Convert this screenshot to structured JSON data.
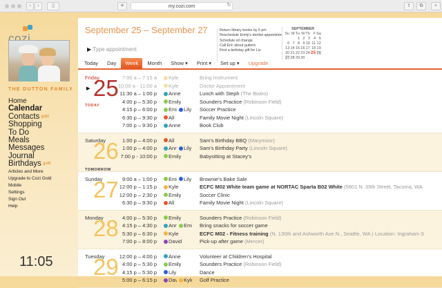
{
  "browser": {
    "url": "my.cozi.com"
  },
  "sidebar": {
    "logo": "cozi",
    "family": "THE DUTTON FAMILY",
    "nav": [
      {
        "label": "Home",
        "size": "md"
      },
      {
        "label": "Calendar",
        "size": "big",
        "selected": true
      },
      {
        "label": "Contacts",
        "size": "big",
        "badge": "gold"
      },
      {
        "label": "Shopping",
        "size": "big"
      },
      {
        "label": "To Do",
        "size": "big"
      },
      {
        "label": "Meals",
        "size": "big"
      },
      {
        "label": "Messages",
        "size": "big"
      },
      {
        "label": "Journal",
        "size": "big"
      },
      {
        "label": "Birthdays",
        "size": "big",
        "badge": "gold"
      },
      {
        "label": "Articles and More",
        "size": "sm"
      },
      {
        "label": "Upgrade to Cozi Gold",
        "size": "sm"
      },
      {
        "label": "Mobile",
        "size": "sm"
      },
      {
        "label": "Settings",
        "size": "sm"
      },
      {
        "label": "Sign Out",
        "size": "sm"
      },
      {
        "label": "Help",
        "size": "sm"
      }
    ],
    "clock": "11:05"
  },
  "header": {
    "range": "September 25 – September 27",
    "type_placeholder": "Type appointment",
    "todos": [
      "Return library books by 5 pm",
      "Reschedule Emily's dentist appointment",
      "Schedule oil change",
      "Call Eric about gutters",
      "Find a birthday gift for Liz"
    ],
    "mini_calendar": {
      "month": "SEPTEMBER",
      "weekdays": [
        "Su",
        "M",
        "Tu",
        "W",
        "Th",
        "F",
        "Sa"
      ],
      "weeks": [
        [
          "",
          "",
          "1",
          "2",
          "3",
          "4",
          "5"
        ],
        [
          "6",
          "7",
          "8",
          "9",
          "10",
          "11",
          "12"
        ],
        [
          "13",
          "14",
          "15",
          "16",
          "17",
          "18",
          "19"
        ],
        [
          "20",
          "21",
          "22",
          "23",
          "24",
          "25",
          "26"
        ],
        [
          "27",
          "28",
          "29",
          "30",
          "",
          "",
          ""
        ]
      ],
      "today": "25"
    },
    "tabs": [
      "Today",
      "Day",
      "Week",
      "Month",
      "Show ▾",
      "Print ▾",
      "Set up ▾",
      "Upgrade"
    ],
    "active_tab": "Week"
  },
  "colors": {
    "Kyle": "#f3b53f",
    "Anne": "#2fa3bd",
    "Emily": "#8ccc4a",
    "Lily": "#2a5fd9",
    "All": "#e5582a",
    "David": "#8e44b8"
  },
  "days": [
    {
      "name": "Friday",
      "num": "25",
      "tag": "TODAY",
      "today": true,
      "events": [
        {
          "time": "7:00 a – 7:15 a",
          "who": [
            "Kyle"
          ],
          "title": "Bring Instrument",
          "past": true
        },
        {
          "time": "10:00 a - 11:00 a",
          "who": [
            "Kyle"
          ],
          "title": "Doctor Appointment",
          "past": true
        },
        {
          "time": "11:30 a – 1:00 p",
          "who": [
            "Anne"
          ],
          "title": "Lunch with Steph",
          "loc": "(The Bistro)"
        },
        {
          "time": "4:00 p – 5:30 p",
          "who": [
            "Emily"
          ],
          "title": "Sounders Practice",
          "loc": "(Robinson Field)"
        },
        {
          "time": "4:15 p – 6:00 p",
          "who": [
            "Emily",
            "Lily"
          ],
          "title": "Soccer Practice"
        },
        {
          "time": "6:30 p – 9:30 p",
          "who": [
            "All"
          ],
          "title": "Family Movie Night",
          "loc": "(Lincoln Square)"
        },
        {
          "time": "7:00 p – 9:30 p",
          "who": [
            "Anne"
          ],
          "title": "Book Club"
        }
      ]
    },
    {
      "name": "Saturday",
      "num": "26",
      "tag": "TOMORROW",
      "events": [
        {
          "time": "1:00 p – 4:00 p",
          "who": [
            "All"
          ],
          "title": "Sam's Birthday BBQ",
          "loc": "(Marymoor)"
        },
        {
          "time": "1:00 p – 4:00 p",
          "who": [
            "Anne",
            "Lily"
          ],
          "title": "Sam's Birthday Party",
          "loc": "(Lincoln Square)"
        },
        {
          "time": "7:00 p - 10:00 p",
          "who": [
            "Emily"
          ],
          "title": "Babysitting at Stacey's"
        }
      ]
    },
    {
      "name": "Sunday",
      "num": "27",
      "events": [
        {
          "time": "9:00 a – 1:00 p",
          "who": [
            "Emily",
            "Lily"
          ],
          "title": "Brownie's Bake Sale"
        },
        {
          "time": "12:00 p – 1:15 p",
          "who": [
            "Kyle"
          ],
          "title": "ECFC M02 White team game at NORTAC Sparta B02 White",
          "loc": "(5801 N. 35th Street, Tacoma, WA",
          "bold": true
        },
        {
          "time": "12:00 p – 2:30 p",
          "who": [
            "Emily"
          ],
          "title": "Soccer Clinic"
        },
        {
          "time": "6:30 p – 9:30 p",
          "who": [
            "All"
          ],
          "title": "Family Movie Night",
          "loc": "(Lincoln Square)"
        }
      ]
    },
    {
      "name": "Monday",
      "num": "28",
      "events": [
        {
          "time": "4:00 p – 5:30 p",
          "who": [
            "Emily"
          ],
          "title": "Sounders Practice",
          "loc": "(Robinson Field)"
        },
        {
          "time": "4:15 p – 4:30 p",
          "who": [
            "Anne",
            "Emily"
          ],
          "title": "Bring snacks for soccer game"
        },
        {
          "time": "5:30 p – 6:30 p",
          "who": [
            "Kyle"
          ],
          "title": "ECFC M02 - Fitness training",
          "loc": "(N. 130th and Ashworth Ave N., Seattle, WA )  Location: Ingraham S",
          "bold": true
        },
        {
          "time": "7:00 p – 8:00 p",
          "who": [
            "David"
          ],
          "title": "Pick-up after game",
          "loc": "(Mercer)"
        }
      ]
    },
    {
      "name": "Tuesday",
      "num": "29",
      "events": [
        {
          "time": "12:00 p – 4:00 p",
          "who": [
            "Anne"
          ],
          "title": "Volunteer at Children's Hospital"
        },
        {
          "time": "4:00 p – 5:30 p",
          "who": [
            "Emily"
          ],
          "title": "Sounders Practice",
          "loc": "(Robinson Field)"
        },
        {
          "time": "4:15 p – 5:30 p",
          "who": [
            "Lily"
          ],
          "title": "Dance"
        },
        {
          "time": "5:00 p – 6:15 p",
          "who": [
            "David",
            "Kyle"
          ],
          "title": "Golf Practice"
        }
      ]
    }
  ]
}
